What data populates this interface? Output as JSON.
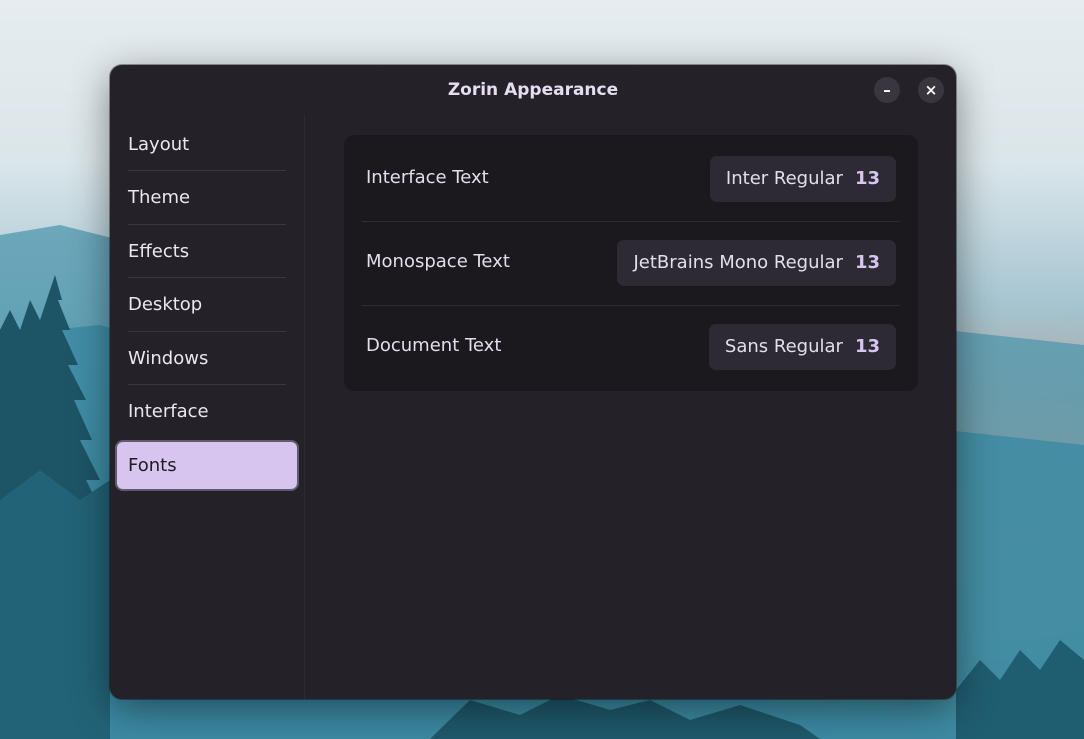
{
  "window": {
    "title": "Zorin Appearance",
    "minimize_glyph": "–",
    "close_glyph": "×"
  },
  "sidebar": {
    "items": [
      {
        "label": "Layout",
        "active": false
      },
      {
        "label": "Theme",
        "active": false
      },
      {
        "label": "Effects",
        "active": false
      },
      {
        "label": "Desktop",
        "active": false
      },
      {
        "label": "Windows",
        "active": false
      },
      {
        "label": "Interface",
        "active": false
      },
      {
        "label": "Fonts",
        "active": true
      }
    ]
  },
  "fonts": {
    "rows": [
      {
        "label": "Interface Text",
        "font": "Inter Regular",
        "size": "13"
      },
      {
        "label": "Monospace Text",
        "font": "JetBrains Mono Regular",
        "size": "13"
      },
      {
        "label": "Document Text",
        "font": "Sans Regular",
        "size": "13"
      }
    ]
  },
  "colors": {
    "accent": "#d7c5f0",
    "window_bg": "#242128",
    "panel_bg": "#1b181e"
  }
}
